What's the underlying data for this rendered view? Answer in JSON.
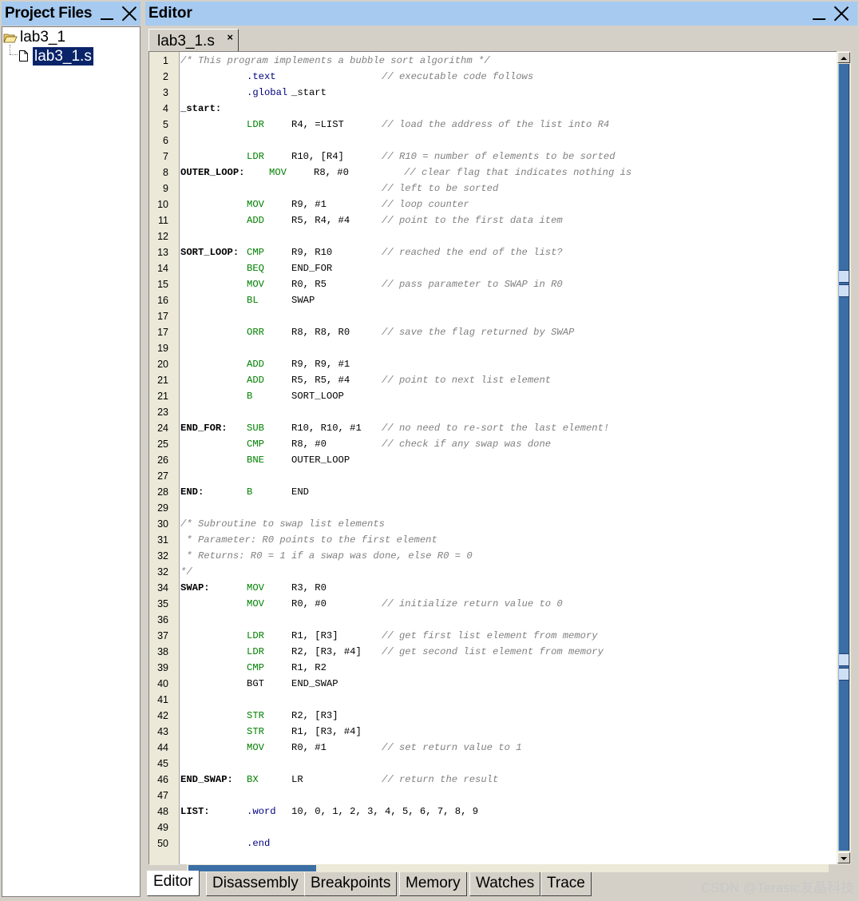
{
  "project_panel": {
    "title": "Project Files",
    "tree": [
      {
        "label": "lab3_1",
        "type": "folder"
      },
      {
        "label": "lab3_1.s",
        "type": "file",
        "selected": true
      }
    ]
  },
  "editor_panel": {
    "title": "Editor",
    "open_tab": {
      "label": "lab3_1.s",
      "close": "×"
    },
    "code_lines": [
      {
        "no": "1",
        "full_comment": "/* This program implements a bubble sort algorithm */"
      },
      {
        "no": "2",
        "op": ".text",
        "op_class": "dir",
        "comment": "// executable code follows"
      },
      {
        "no": "3",
        "op": ".global",
        "op_class": "dir",
        "args": "_start",
        "shift_args": true
      },
      {
        "no": "4",
        "label": "_start:"
      },
      {
        "no": "5",
        "op": "LDR",
        "args": "R4, =LIST",
        "comment": "// load the address of the list into R4"
      },
      {
        "no": "6"
      },
      {
        "no": "7",
        "op": "LDR",
        "args": "R10, [R4]",
        "comment": "// R10 = number of elements to be sorted"
      },
      {
        "no": "8",
        "label": "OUTER_LOOP:",
        "op": "MOV",
        "args": "R8, #0",
        "comment": "// clear flag that indicates nothing is",
        "shifted": true
      },
      {
        "no": "9",
        "comment": "// left to be sorted"
      },
      {
        "no": "10",
        "op": "MOV",
        "args": "R9, #1",
        "comment": "// loop counter"
      },
      {
        "no": "11",
        "op": "ADD",
        "args": "R5, R4, #4",
        "comment": "// point to the first data item"
      },
      {
        "no": "12"
      },
      {
        "no": "13",
        "label": "SORT_LOOP:",
        "op": "CMP",
        "args": "R9, R10",
        "comment": "// reached the end of the list?"
      },
      {
        "no": "14",
        "op": "BEQ",
        "args": "END_FOR"
      },
      {
        "no": "15",
        "op": "MOV",
        "args": "R0, R5",
        "comment": "// pass parameter to SWAP in R0"
      },
      {
        "no": "16",
        "op": "BL",
        "args": "SWAP"
      },
      {
        "no": "17"
      },
      {
        "no": "17",
        "op": "ORR",
        "args": "R8, R8, R0",
        "comment": "// save the flag returned by SWAP"
      },
      {
        "no": "19"
      },
      {
        "no": "20",
        "op": "ADD",
        "args": "R9, R9, #1"
      },
      {
        "no": "21",
        "op": "ADD",
        "args": "R5, R5, #4",
        "comment": "// point to next list element"
      },
      {
        "no": "21",
        "op": "B",
        "args": "SORT_LOOP"
      },
      {
        "no": "23"
      },
      {
        "no": "24",
        "label": "END_FOR:",
        "op": "SUB",
        "args": "R10, R10, #1",
        "comment": "// no need to re-sort the last element!"
      },
      {
        "no": "25",
        "op": "CMP",
        "args": "R8, #0",
        "comment": "// check if any swap was done"
      },
      {
        "no": "26",
        "op": "BNE",
        "args": "OUTER_LOOP"
      },
      {
        "no": "27"
      },
      {
        "no": "28",
        "label": "END:",
        "op": "B",
        "args": "END"
      },
      {
        "no": "29"
      },
      {
        "no": "30",
        "full_comment": "/* Subroutine to swap list elements"
      },
      {
        "no": "31",
        "full_comment": " * Parameter: R0 points to the first element"
      },
      {
        "no": "32",
        "full_comment": " * Returns: R0 = 1 if a swap was done, else R0 = 0"
      },
      {
        "no": "32",
        "full_comment": "*/"
      },
      {
        "no": "34",
        "label": "SWAP:",
        "op": "MOV",
        "args": "R3, R0"
      },
      {
        "no": "35",
        "op": "MOV",
        "args": "R0, #0",
        "comment": "// initialize return value to 0"
      },
      {
        "no": "36"
      },
      {
        "no": "37",
        "op": "LDR",
        "args": "R1, [R3]",
        "comment": "// get first list element from memory"
      },
      {
        "no": "38",
        "op": "LDR",
        "args": "R2, [R3, #4]",
        "comment": "// get second list element from memory"
      },
      {
        "no": "39",
        "op": "CMP",
        "args": "R1, R2"
      },
      {
        "no": "40",
        "op": "BGT",
        "op_class": "plain",
        "args": "END_SWAP"
      },
      {
        "no": "41"
      },
      {
        "no": "42",
        "op": "STR",
        "args": "R2, [R3]"
      },
      {
        "no": "43",
        "op": "STR",
        "args": "R1, [R3, #4]"
      },
      {
        "no": "44",
        "op": "MOV",
        "args": "R0, #1",
        "comment": "// set return value to 1"
      },
      {
        "no": "45"
      },
      {
        "no": "46",
        "label": "END_SWAP:",
        "op": "BX",
        "args": "LR",
        "comment": "// return the result"
      },
      {
        "no": "47"
      },
      {
        "no": "48",
        "label": "LIST:",
        "op": ".word",
        "op_class": "dir",
        "args": "10, 0, 1, 2, 3, 4, 5, 6, 7, 8, 9"
      },
      {
        "no": "49"
      },
      {
        "no": "50",
        "op": ".end",
        "op_class": "dir"
      }
    ]
  },
  "bottom_tabs": [
    "Editor",
    "Disassembly",
    "Breakpoints",
    "Memory",
    "Watches",
    "Trace"
  ],
  "watermark": "CSDN @Terasic友晶科技",
  "colors": {
    "header_bg": "#a6caf0",
    "selection": "#0a246a",
    "instruction": "#008000",
    "directive": "#000080",
    "comment": "#808080",
    "scroll_thumb": "#3a6ea5"
  },
  "icons": [
    "folder-open-icon",
    "file-icon",
    "minimize-icon",
    "close-icon",
    "scroll-up-icon",
    "scroll-down-icon",
    "scroll-left-icon",
    "scroll-right-icon"
  ]
}
